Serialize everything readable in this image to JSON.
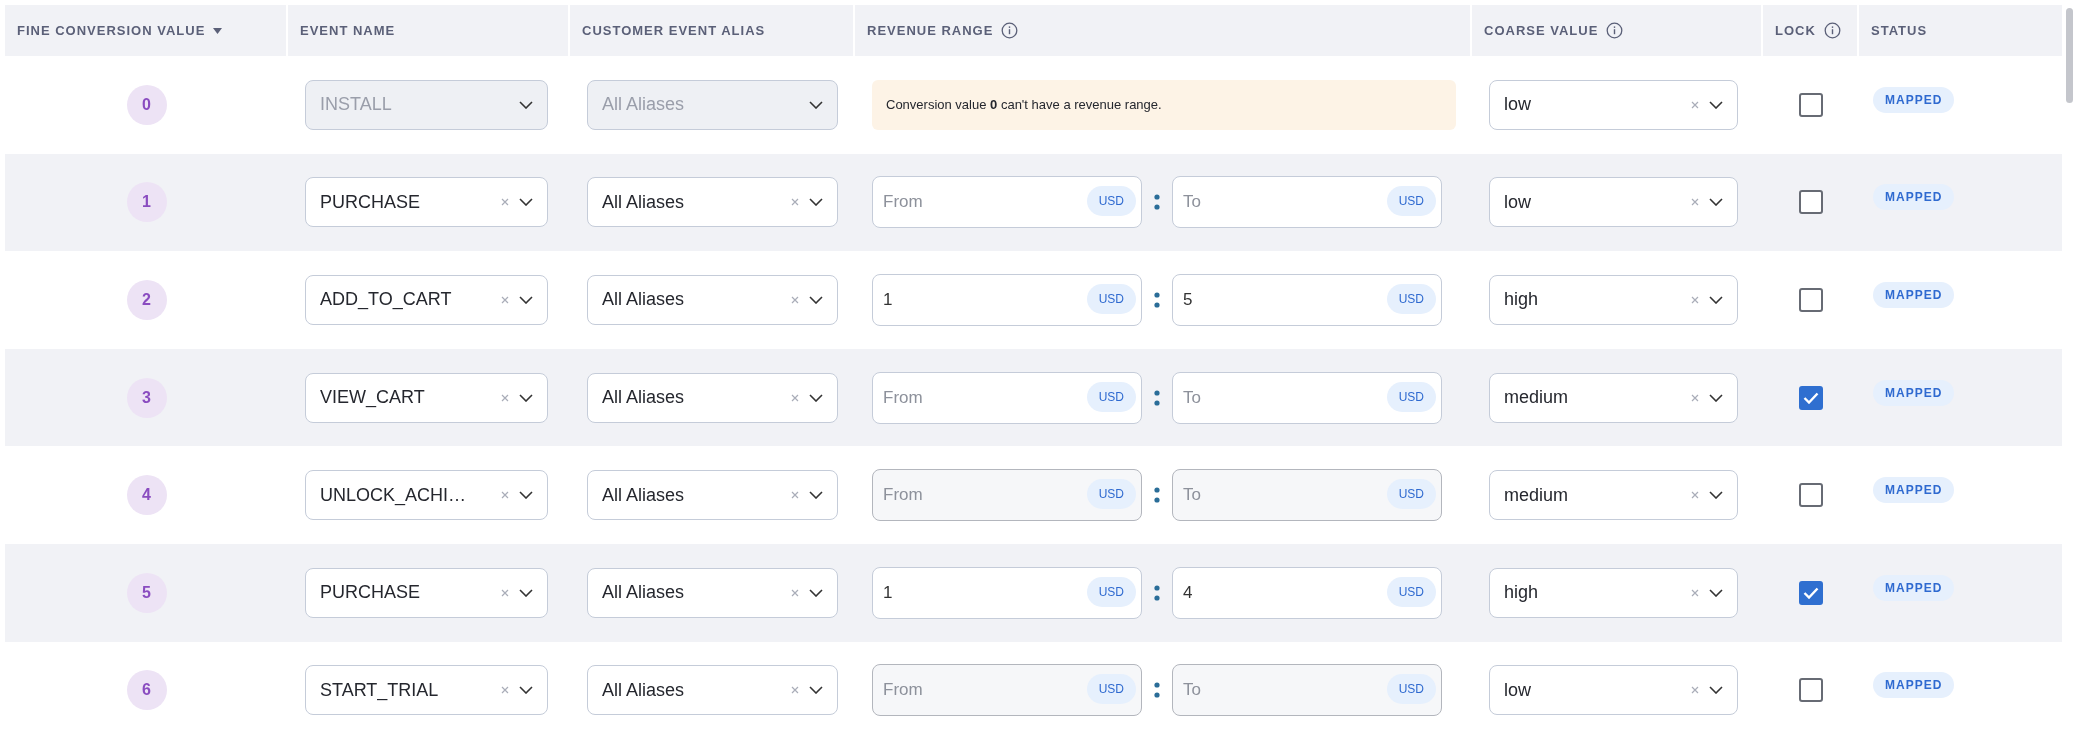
{
  "table": {
    "columns": [
      {
        "label": "FINE CONVERSION VALUE",
        "sort_icon": true,
        "info_icon": false
      },
      {
        "label": "EVENT NAME",
        "sort_icon": false,
        "info_icon": false
      },
      {
        "label": "CUSTOMER EVENT ALIAS",
        "sort_icon": false,
        "info_icon": false
      },
      {
        "label": "REVENUE RANGE",
        "sort_icon": false,
        "info_icon": true
      },
      {
        "label": "COARSE VALUE",
        "sort_icon": false,
        "info_icon": true
      },
      {
        "label": "LOCK",
        "sort_icon": false,
        "info_icon": true
      },
      {
        "label": "STATUS",
        "sort_icon": false,
        "info_icon": false
      }
    ],
    "rows": [
      {
        "value": "0",
        "event": {
          "value": "INSTALL",
          "disabled": true
        },
        "alias": {
          "value": "All Aliases",
          "disabled": true
        },
        "revenue": {
          "kind": "note",
          "text": "Conversion value **0** can't have a revenue range."
        },
        "coarse": {
          "value": "low",
          "disabled": false
        },
        "locked": false,
        "status": "MAPPED"
      },
      {
        "value": "1",
        "event": {
          "value": "PURCHASE",
          "disabled": false
        },
        "alias": {
          "value": "All Aliases",
          "disabled": false
        },
        "revenue": {
          "kind": "range",
          "disabled": false,
          "from": {
            "placeholder": "From",
            "currency": "USD"
          },
          "to": {
            "placeholder": "To",
            "currency": "USD"
          }
        },
        "coarse": {
          "value": "low",
          "disabled": false
        },
        "locked": false,
        "status": "MAPPED"
      },
      {
        "value": "2",
        "event": {
          "value": "ADD_TO_CART",
          "disabled": false
        },
        "alias": {
          "value": "All Aliases",
          "disabled": false
        },
        "revenue": {
          "kind": "range",
          "disabled": false,
          "from": {
            "value": "1",
            "currency": "USD"
          },
          "to": {
            "value": "5",
            "currency": "USD"
          }
        },
        "coarse": {
          "value": "high",
          "disabled": false
        },
        "locked": false,
        "status": "MAPPED"
      },
      {
        "value": "3",
        "event": {
          "value": "VIEW_CART",
          "disabled": false
        },
        "alias": {
          "value": "All Aliases",
          "disabled": false
        },
        "revenue": {
          "kind": "range",
          "disabled": false,
          "from": {
            "placeholder": "From",
            "currency": "USD"
          },
          "to": {
            "placeholder": "To",
            "currency": "USD"
          }
        },
        "coarse": {
          "value": "medium",
          "disabled": false
        },
        "locked": true,
        "status": "MAPPED"
      },
      {
        "value": "4",
        "event": {
          "value": "UNLOCK_ACHI…",
          "disabled": false
        },
        "alias": {
          "value": "All Aliases",
          "disabled": false
        },
        "revenue": {
          "kind": "range",
          "disabled": true,
          "from": {
            "placeholder": "From",
            "currency": "USD"
          },
          "to": {
            "placeholder": "To",
            "currency": "USD"
          }
        },
        "coarse": {
          "value": "medium",
          "disabled": false
        },
        "locked": false,
        "status": "MAPPED"
      },
      {
        "value": "5",
        "event": {
          "value": "PURCHASE",
          "disabled": false
        },
        "alias": {
          "value": "All Aliases",
          "disabled": false
        },
        "revenue": {
          "kind": "range",
          "disabled": false,
          "from": {
            "value": "1",
            "currency": "USD"
          },
          "to": {
            "value": "4",
            "currency": "USD"
          }
        },
        "coarse": {
          "value": "high",
          "disabled": false
        },
        "locked": true,
        "status": "MAPPED"
      },
      {
        "value": "6",
        "event": {
          "value": "START_TRIAL",
          "disabled": false
        },
        "alias": {
          "value": "All Aliases",
          "disabled": false
        },
        "revenue": {
          "kind": "range",
          "disabled": true,
          "from": {
            "placeholder": "From",
            "currency": "USD"
          },
          "to": {
            "placeholder": "To",
            "currency": "USD"
          }
        },
        "coarse": {
          "value": "low",
          "disabled": false
        },
        "locked": false,
        "status": "MAPPED"
      }
    ]
  }
}
